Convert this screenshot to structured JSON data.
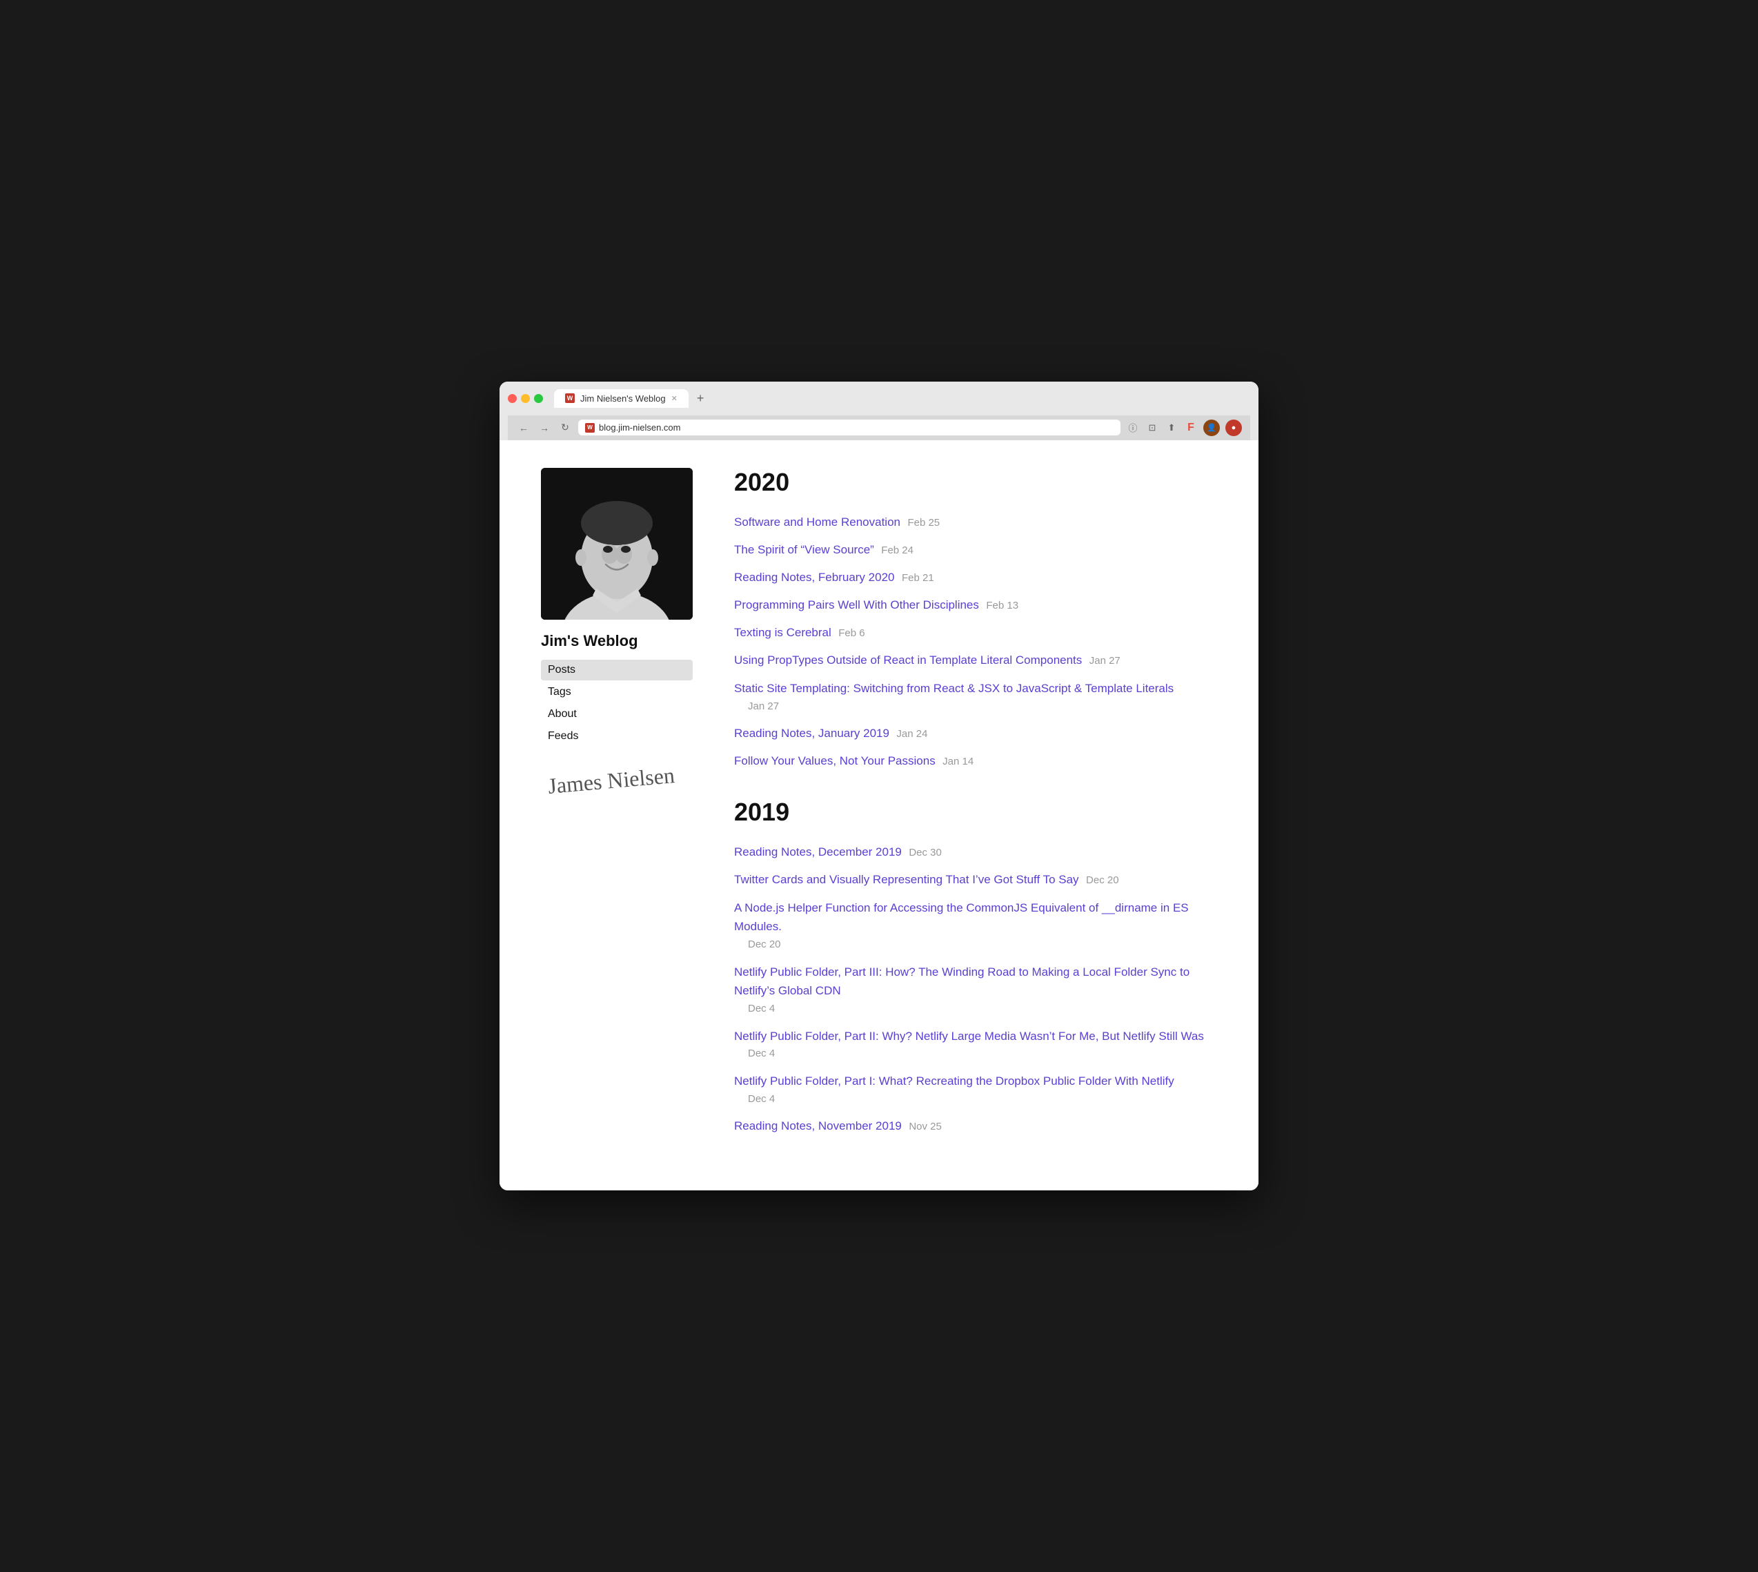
{
  "browser": {
    "tab_title": "Jim Nielsen's Weblog",
    "url": "blog.jim-nielsen.com",
    "favicon_text": "W"
  },
  "sidebar": {
    "site_title": "Jim's Weblog",
    "nav": [
      {
        "label": "Posts",
        "active": true,
        "href": "#"
      },
      {
        "label": "Tags",
        "active": false,
        "href": "#"
      },
      {
        "label": "About",
        "active": false,
        "href": "#"
      },
      {
        "label": "Feeds",
        "active": false,
        "href": "#"
      }
    ]
  },
  "main": {
    "years": [
      {
        "year": "2020",
        "posts": [
          {
            "title": "Software and Home Renovation",
            "date": "Feb 25",
            "multiline": false
          },
          {
            "title": "The Spirit of “View Source”",
            "date": "Feb 24",
            "multiline": false
          },
          {
            "title": "Reading Notes, February 2020",
            "date": "Feb 21",
            "multiline": false
          },
          {
            "title": "Programming Pairs Well With Other Disciplines",
            "date": "Feb 13",
            "multiline": false
          },
          {
            "title": "Texting is Cerebral",
            "date": "Feb 6",
            "multiline": false
          },
          {
            "title": "Using PropTypes Outside of React in Template Literal Components",
            "date": "Jan 27",
            "multiline": false
          },
          {
            "title": "Static Site Templating: Switching from React & JSX to JavaScript & Template Literals",
            "date": "Jan 27",
            "multiline": true
          },
          {
            "title": "Reading Notes, January 2019",
            "date": "Jan 24",
            "multiline": false
          },
          {
            "title": "Follow Your Values, Not Your Passions",
            "date": "Jan 14",
            "multiline": false
          }
        ]
      },
      {
        "year": "2019",
        "posts": [
          {
            "title": "Reading Notes, December 2019",
            "date": "Dec 30",
            "multiline": false
          },
          {
            "title": "Twitter Cards and Visually Representing That I’ve Got Stuff To Say",
            "date": "Dec 20",
            "multiline": false
          },
          {
            "title": "A Node.js Helper Function for Accessing the CommonJS Equivalent of __dirname in ES Modules.",
            "date": "Dec 20",
            "multiline": true
          },
          {
            "title": "Netlify Public Folder, Part III: How? The Winding Road to Making a Local Folder Sync to Netlify’s Global CDN",
            "date": "Dec 4",
            "multiline": true
          },
          {
            "title": "Netlify Public Folder, Part II: Why? Netlify Large Media Wasn’t For Me, But Netlify Still Was",
            "date": "Dec 4",
            "multiline": true
          },
          {
            "title": "Netlify Public Folder, Part I: What? Recreating the Dropbox Public Folder With Netlify",
            "date": "Dec 4",
            "multiline": true
          },
          {
            "title": "Reading Notes, November 2019",
            "date": "Nov 25",
            "multiline": false
          }
        ]
      }
    ]
  }
}
